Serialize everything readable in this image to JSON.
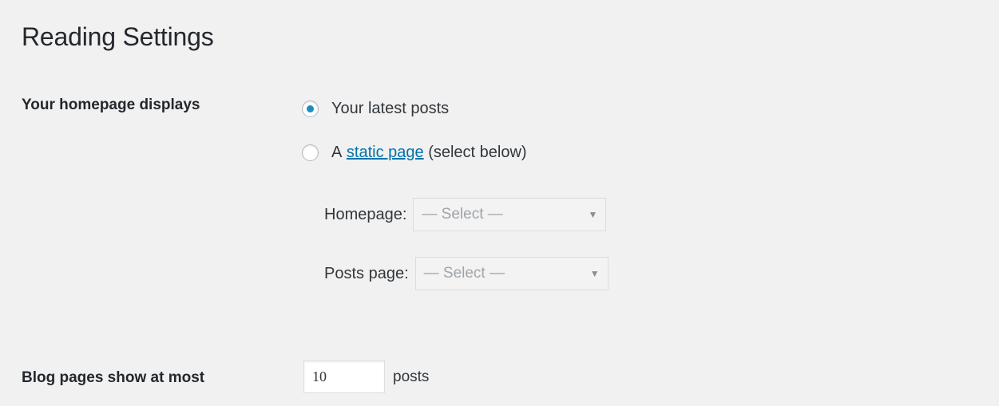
{
  "page": {
    "title": "Reading Settings"
  },
  "homepage_displays": {
    "label": "Your homepage displays",
    "options": [
      {
        "label": "Your latest posts",
        "checked": true
      },
      {
        "prefix": "A",
        "link_text": "static page",
        "suffix": "(select below)",
        "checked": false
      }
    ],
    "homepage_select": {
      "label": "Homepage:",
      "value": "— Select —"
    },
    "posts_page_select": {
      "label": "Posts page:",
      "value": "— Select —"
    }
  },
  "blog_pages": {
    "label": "Blog pages show at most",
    "value": "10",
    "unit": "posts"
  },
  "colors": {
    "accent": "#0073aa",
    "radio_checked": "#1e8cbe",
    "background": "#f1f1f1"
  }
}
